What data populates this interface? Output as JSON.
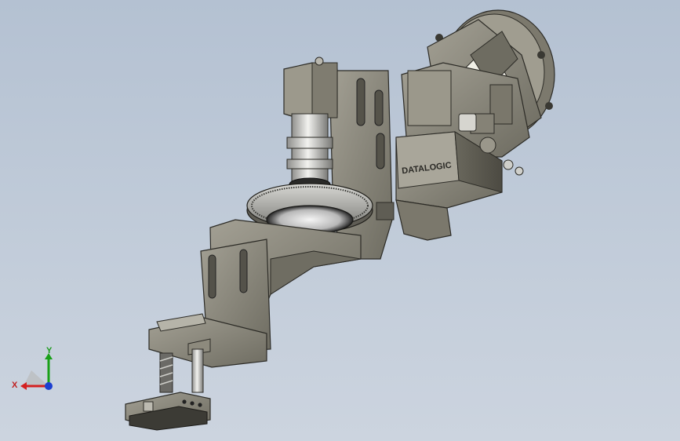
{
  "viewport": {
    "background_top": "#b4c1d2",
    "background_bottom": "#ccd4df"
  },
  "model": {
    "part_color": "#8d8a7d",
    "part_shadow": "#5f5d54",
    "part_highlight": "#c4c2b8",
    "metal_color": "#c9c9c6",
    "camera_brand_text": "DATALOGIC"
  },
  "triad": {
    "x_label": "X",
    "y_label": "Y",
    "x_color": "#d42020",
    "y_color": "#18a018",
    "z_color": "#1c3fd0"
  }
}
